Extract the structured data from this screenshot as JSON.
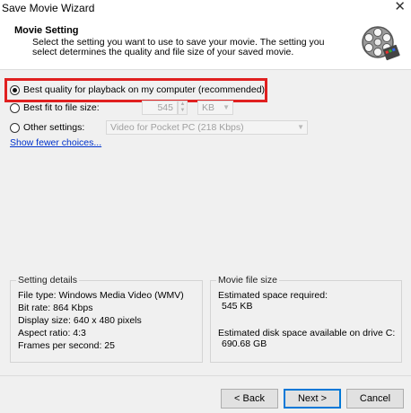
{
  "window": {
    "title": "Save Movie Wizard",
    "close_glyph": "✕"
  },
  "header": {
    "title": "Movie Setting",
    "description": "Select the setting you want to use to save your movie. The setting you select determines the quality and file size of your saved movie.",
    "icon": "film-reel-icon"
  },
  "options": {
    "best_quality": {
      "label": "Best quality for playback on my computer (recommended)",
      "selected": true
    },
    "best_fit": {
      "label": "Best fit to file size:",
      "size_value": "545",
      "unit": "KB",
      "selected": false
    },
    "other": {
      "label": "Other settings:",
      "value": "Video for Pocket PC (218 Kbps)",
      "selected": false
    },
    "show_fewer_link": "Show fewer choices..."
  },
  "setting_details": {
    "title": "Setting details",
    "lines": [
      "File type: Windows Media Video (WMV)",
      "Bit rate: 864 Kbps",
      "Display size: 640 x 480 pixels",
      "Aspect ratio: 4:3",
      "Frames per second: 25"
    ]
  },
  "movie_file_size": {
    "title": "Movie file size",
    "required_label": "Estimated space required:",
    "required_value": "545 KB",
    "available_label": "Estimated disk space available on drive C:",
    "available_value": "690.68 GB"
  },
  "buttons": {
    "back": "< Back",
    "next": "Next >",
    "cancel": "Cancel"
  },
  "colors": {
    "highlight": "#e02020",
    "link": "#0033cc"
  }
}
